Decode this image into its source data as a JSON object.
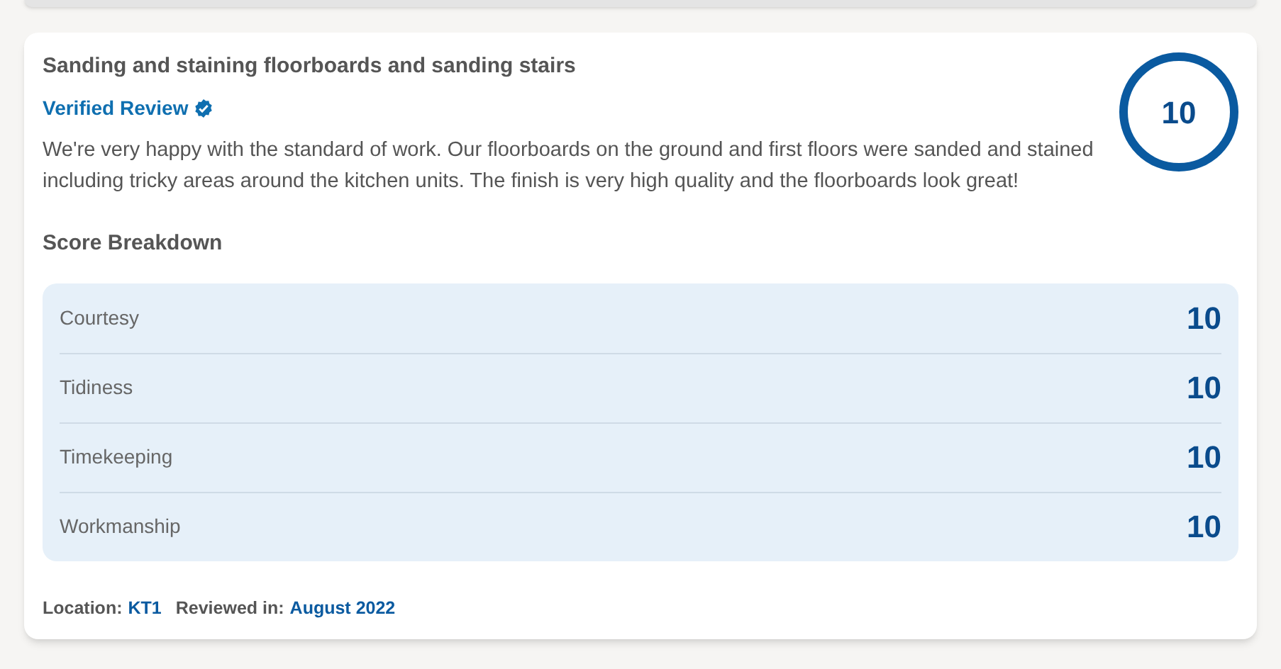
{
  "review": {
    "title": "Sanding and staining floorboards and sanding stairs",
    "verified": "Verified Review",
    "score": "10",
    "text": "We're very happy with the standard of work. Our floorboards on the ground and first floors were sanded and stained including tricky areas around the kitchen units. The finish is very high quality and the floorboards look great!"
  },
  "breakdown": {
    "heading": "Score Breakdown",
    "rows": [
      {
        "label": "Courtesy",
        "score": "10"
      },
      {
        "label": "Tidiness",
        "score": "10"
      },
      {
        "label": "Timekeeping",
        "score": "10"
      },
      {
        "label": "Workmanship",
        "score": "10"
      }
    ]
  },
  "footer": [
    {
      "label": "Location:",
      "value": "KT1"
    },
    {
      "label": "Reviewed in:",
      "value": "August 2022"
    }
  ]
}
